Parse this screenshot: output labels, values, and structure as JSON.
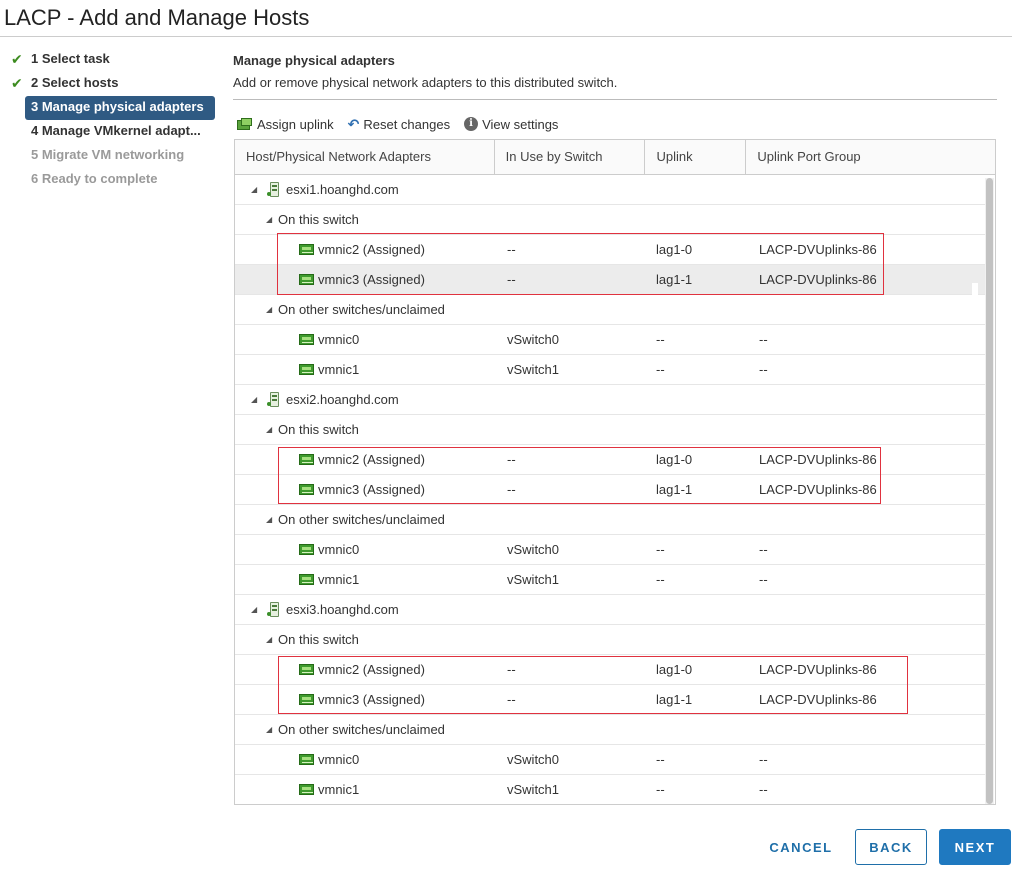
{
  "window": {
    "title": "LACP - Add and Manage Hosts"
  },
  "steps": [
    {
      "label": "1 Select task",
      "state": "done"
    },
    {
      "label": "2 Select hosts",
      "state": "done"
    },
    {
      "label": "3 Manage physical adapters",
      "state": "active"
    },
    {
      "label": "4 Manage VMkernel adapt...",
      "state": "todo"
    },
    {
      "label": "5 Migrate VM networking",
      "state": "disabled"
    },
    {
      "label": "6 Ready to complete",
      "state": "disabled"
    }
  ],
  "main": {
    "heading": "Manage physical adapters",
    "description": "Add or remove physical network adapters to this distributed switch."
  },
  "toolbar": {
    "assign_uplink": "Assign uplink",
    "reset_changes": "Reset changes",
    "view_settings": "View settings"
  },
  "table": {
    "columns": [
      "Host/Physical Network Adapters",
      "In Use by Switch",
      "Uplink",
      "Uplink Port Group"
    ],
    "rows": [
      {
        "type": "host",
        "name": "esxi1.hoanghd.com"
      },
      {
        "type": "group",
        "name": "On this switch"
      },
      {
        "type": "nic",
        "name": "vmnic2 (Assigned)",
        "switch": "--",
        "uplink": "lag1-0",
        "portgroup": "LACP-DVUplinks-86"
      },
      {
        "type": "nic",
        "name": "vmnic3 (Assigned)",
        "switch": "--",
        "uplink": "lag1-1",
        "portgroup": "LACP-DVUplinks-86",
        "selected": true
      },
      {
        "type": "group",
        "name": "On other switches/unclaimed"
      },
      {
        "type": "nic",
        "name": "vmnic0",
        "switch": "vSwitch0",
        "uplink": "--",
        "portgroup": "--"
      },
      {
        "type": "nic",
        "name": "vmnic1",
        "switch": "vSwitch1",
        "uplink": "--",
        "portgroup": "--"
      },
      {
        "type": "host",
        "name": "esxi2.hoanghd.com"
      },
      {
        "type": "group",
        "name": "On this switch"
      },
      {
        "type": "nic",
        "name": "vmnic2 (Assigned)",
        "switch": "--",
        "uplink": "lag1-0",
        "portgroup": "LACP-DVUplinks-86"
      },
      {
        "type": "nic",
        "name": "vmnic3 (Assigned)",
        "switch": "--",
        "uplink": "lag1-1",
        "portgroup": "LACP-DVUplinks-86"
      },
      {
        "type": "group",
        "name": "On other switches/unclaimed"
      },
      {
        "type": "nic",
        "name": "vmnic0",
        "switch": "vSwitch0",
        "uplink": "--",
        "portgroup": "--"
      },
      {
        "type": "nic",
        "name": "vmnic1",
        "switch": "vSwitch1",
        "uplink": "--",
        "portgroup": "--"
      },
      {
        "type": "host",
        "name": "esxi3.hoanghd.com"
      },
      {
        "type": "group",
        "name": "On this switch"
      },
      {
        "type": "nic",
        "name": "vmnic2 (Assigned)",
        "switch": "--",
        "uplink": "lag1-0",
        "portgroup": "LACP-DVUplinks-86"
      },
      {
        "type": "nic",
        "name": "vmnic3 (Assigned)",
        "switch": "--",
        "uplink": "lag1-1",
        "portgroup": "LACP-DVUplinks-86"
      },
      {
        "type": "group",
        "name": "On other switches/unclaimed"
      },
      {
        "type": "nic",
        "name": "vmnic0",
        "switch": "vSwitch0",
        "uplink": "--",
        "portgroup": "--"
      },
      {
        "type": "nic",
        "name": "vmnic1",
        "switch": "vSwitch1",
        "uplink": "--",
        "portgroup": "--"
      }
    ]
  },
  "buttons": {
    "cancel": "CANCEL",
    "back": "BACK",
    "next": "NEXT"
  },
  "colors": {
    "accent": "#1f79c0",
    "active_step": "#2f5a83",
    "highlight_box": "#e0323f",
    "check": "#3c8b1f"
  },
  "icons": {
    "done_step": "checkmark-icon",
    "host": "host-server-icon",
    "adapter": "network-adapter-icon",
    "expander": "triangle-down-icon"
  }
}
